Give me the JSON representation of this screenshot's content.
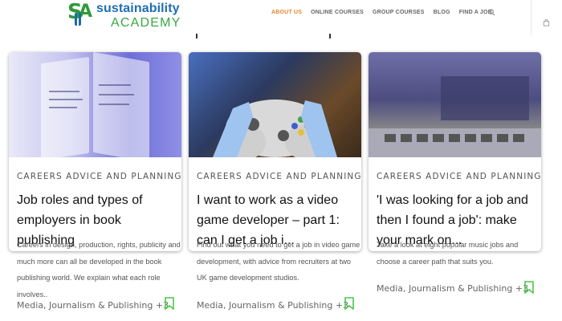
{
  "header": {
    "logo_top": "sustainability",
    "logo_bottom": "ACADEMY",
    "nav": [
      {
        "label": "ABOUT US",
        "active": true
      },
      {
        "label": "ONLINE COURSES",
        "active": false
      },
      {
        "label": "GROUP COURSES",
        "active": false
      },
      {
        "label": "BLOG",
        "active": false
      },
      {
        "label": "FIND A JOB",
        "active": false
      }
    ],
    "icons": [
      "search-icon",
      "cart-icon"
    ],
    "colors": {
      "active_nav": "#e8872a",
      "logo_blue": "#1f6fb3",
      "logo_green": "#36a845",
      "bookmark": "#4cc84a"
    }
  },
  "cards": [
    {
      "category": "CAREERS ADVICE AND PLANNING",
      "title": "Job roles and types of employers in book publishing",
      "excerpt": "Careers in design, production, rights, publicity and much more can all be developed in the book publishing world. We explain what each role involves..",
      "tags": "Media, Journalism & Publishing +3",
      "image": "books"
    },
    {
      "category": "CAREERS ADVICE AND PLANNING",
      "title": "I want to work as a video game developer – part 1: can I get a job i...",
      "excerpt": "Find out what you need to get a job in video game development, with advice from recruiters at two UK game development studios.",
      "tags": "Media, Journalism & Publishing +3",
      "image": "game-controller"
    },
    {
      "category": "CAREERS ADVICE AND PLANNING",
      "title": "'I was looking for a job and then I found a job': make your mark on...",
      "excerpt": "Take a look at eight popular music jobs and choose a career path that suits you.",
      "tags": "Media, Journalism & Publishing +3",
      "image": "music-equipment"
    }
  ]
}
